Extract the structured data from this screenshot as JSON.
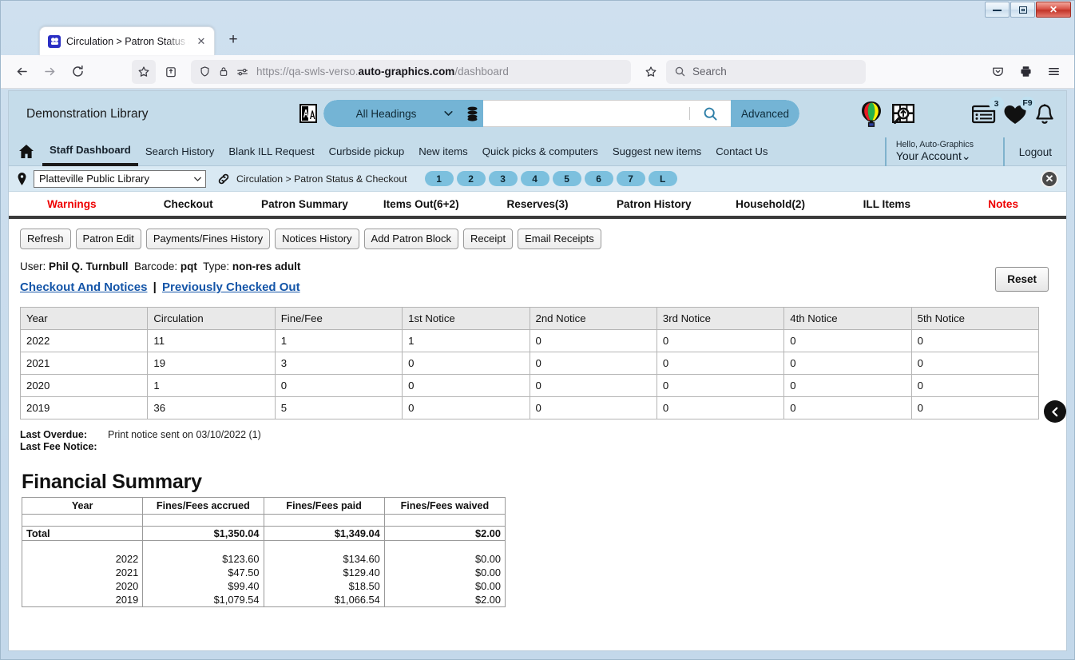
{
  "window": {
    "minimize_label": "Minimize",
    "maximize_label": "Restore",
    "close_label": "✕"
  },
  "browser": {
    "tab": {
      "title": "Circulation > Patron Status & C",
      "favicon_name": "verso-favicon",
      "close_label": "✕"
    },
    "newtab_label": "+",
    "url": {
      "scheme": "https://qa-swls-verso.",
      "domain": "auto-graphics.com",
      "path": "/dashboard"
    },
    "search_placeholder": "Search",
    "icons": {
      "back": "back-arrow-icon",
      "forward": "forward-arrow-icon",
      "reload": "reload-icon",
      "bookmark": "star-icon",
      "save_to_pocket_toolbar": "pocket-save-icon",
      "shield": "shield-icon",
      "lock": "lock-icon",
      "permissions": "permissions-icon",
      "pocket": "pocket-icon",
      "print": "print-icon",
      "menu": "hamburger-menu-icon"
    }
  },
  "app": {
    "library_name": "Demonstration Library",
    "search": {
      "scope_label": "All Headings",
      "value": "",
      "advanced_label": "Advanced",
      "lang_icon": "translate-icon",
      "db_icon": "database-icon",
      "go_icon": "search-icon"
    },
    "header_icons": [
      {
        "name": "balloon-icon",
        "badge": ""
      },
      {
        "name": "book-search-icon",
        "badge": ""
      },
      {
        "name": "list-icon",
        "badge": "3"
      },
      {
        "name": "heart-icon",
        "badge": "F9"
      },
      {
        "name": "bell-icon",
        "badge": ""
      }
    ],
    "nav_links": [
      {
        "label": "Staff Dashboard",
        "active": true
      },
      {
        "label": "Search History",
        "active": false
      },
      {
        "label": "Blank ILL Request",
        "active": false
      },
      {
        "label": "Curbside pickup",
        "active": false
      },
      {
        "label": "New items",
        "active": false
      },
      {
        "label": "Quick picks & computers",
        "active": false
      },
      {
        "label": "Suggest new items",
        "active": false
      },
      {
        "label": "Contact Us",
        "active": false
      }
    ],
    "account": {
      "hello": "Hello, Auto-Graphics",
      "name": "Your Account",
      "chevron": "⌄",
      "logout": "Logout"
    },
    "context": {
      "location": "Platteville Public Library",
      "breadcrumb": "Circulation > Patron Status & Checkout",
      "pills": [
        "1",
        "2",
        "3",
        "4",
        "5",
        "6",
        "7",
        "L"
      ],
      "close_label": "✕"
    },
    "tabs": [
      {
        "label": "Warnings",
        "style": "warn"
      },
      {
        "label": "Checkout",
        "style": "normal"
      },
      {
        "label": "Patron Summary",
        "style": "normal"
      },
      {
        "label": "Items Out(6+2)",
        "style": "normal"
      },
      {
        "label": "Reserves(3)",
        "style": "normal"
      },
      {
        "label": "Patron History",
        "style": "normal"
      },
      {
        "label": "Household(2)",
        "style": "normal"
      },
      {
        "label": "ILL Items",
        "style": "normal"
      },
      {
        "label": "Notes",
        "style": "warn"
      }
    ]
  },
  "main": {
    "action_buttons": [
      "Refresh",
      "Patron Edit",
      "Payments/Fines History",
      "Notices History",
      "Add Patron Block",
      "Receipt",
      "Email Receipts"
    ],
    "reset_label": "Reset",
    "patron": {
      "user_label": "User:",
      "user_value": "Phil Q. Turnbull",
      "barcode_label": "Barcode:",
      "barcode_value": "pqt",
      "type_label": "Type:",
      "type_value": "non-res adult"
    },
    "links": {
      "checkout_and_notices": "Checkout And Notices",
      "separator": "|",
      "previously_checked_out": "Previously Checked Out"
    },
    "circulation_table": {
      "headers": [
        "Year",
        "Circulation",
        "Fine/Fee",
        "1st Notice",
        "2nd Notice",
        "3rd Notice",
        "4th Notice",
        "5th Notice"
      ],
      "rows": [
        [
          "2022",
          "11",
          "1",
          "1",
          "0",
          "0",
          "0",
          "0"
        ],
        [
          "2021",
          "19",
          "3",
          "0",
          "0",
          "0",
          "0",
          "0"
        ],
        [
          "2020",
          "1",
          "0",
          "0",
          "0",
          "0",
          "0",
          "0"
        ],
        [
          "2019",
          "36",
          "5",
          "0",
          "0",
          "0",
          "0",
          "0"
        ]
      ],
      "scroll_left_icon": "chevron-left-icon"
    },
    "notices": {
      "last_overdue_label": "Last Overdue:",
      "last_overdue_value": "Print notice sent on 03/10/2022 (1)",
      "last_fee_notice_label": "Last Fee Notice:",
      "last_fee_notice_value": ""
    },
    "financial": {
      "title": "Financial Summary",
      "headers": [
        "Year",
        "Fines/Fees accrued",
        "Fines/Fees paid",
        "Fines/Fees waived"
      ],
      "total_row": [
        "Total",
        "$1,350.04",
        "$1,349.04",
        "$2.00"
      ],
      "rows": [
        [
          "2022",
          "$123.60",
          "$134.60",
          "$0.00"
        ],
        [
          "2021",
          "$47.50",
          "$129.40",
          "$0.00"
        ],
        [
          "2020",
          "$99.40",
          "$18.50",
          "$0.00"
        ],
        [
          "2019",
          "$1,079.54",
          "$1,066.54",
          "$2.00"
        ]
      ]
    }
  },
  "colors": {
    "header_blue": "#c5dcea",
    "accent_blue": "#74b4d5",
    "pill_blue": "#7cc0de",
    "warn_red": "#ee0000",
    "link_blue": "#1455a8"
  }
}
